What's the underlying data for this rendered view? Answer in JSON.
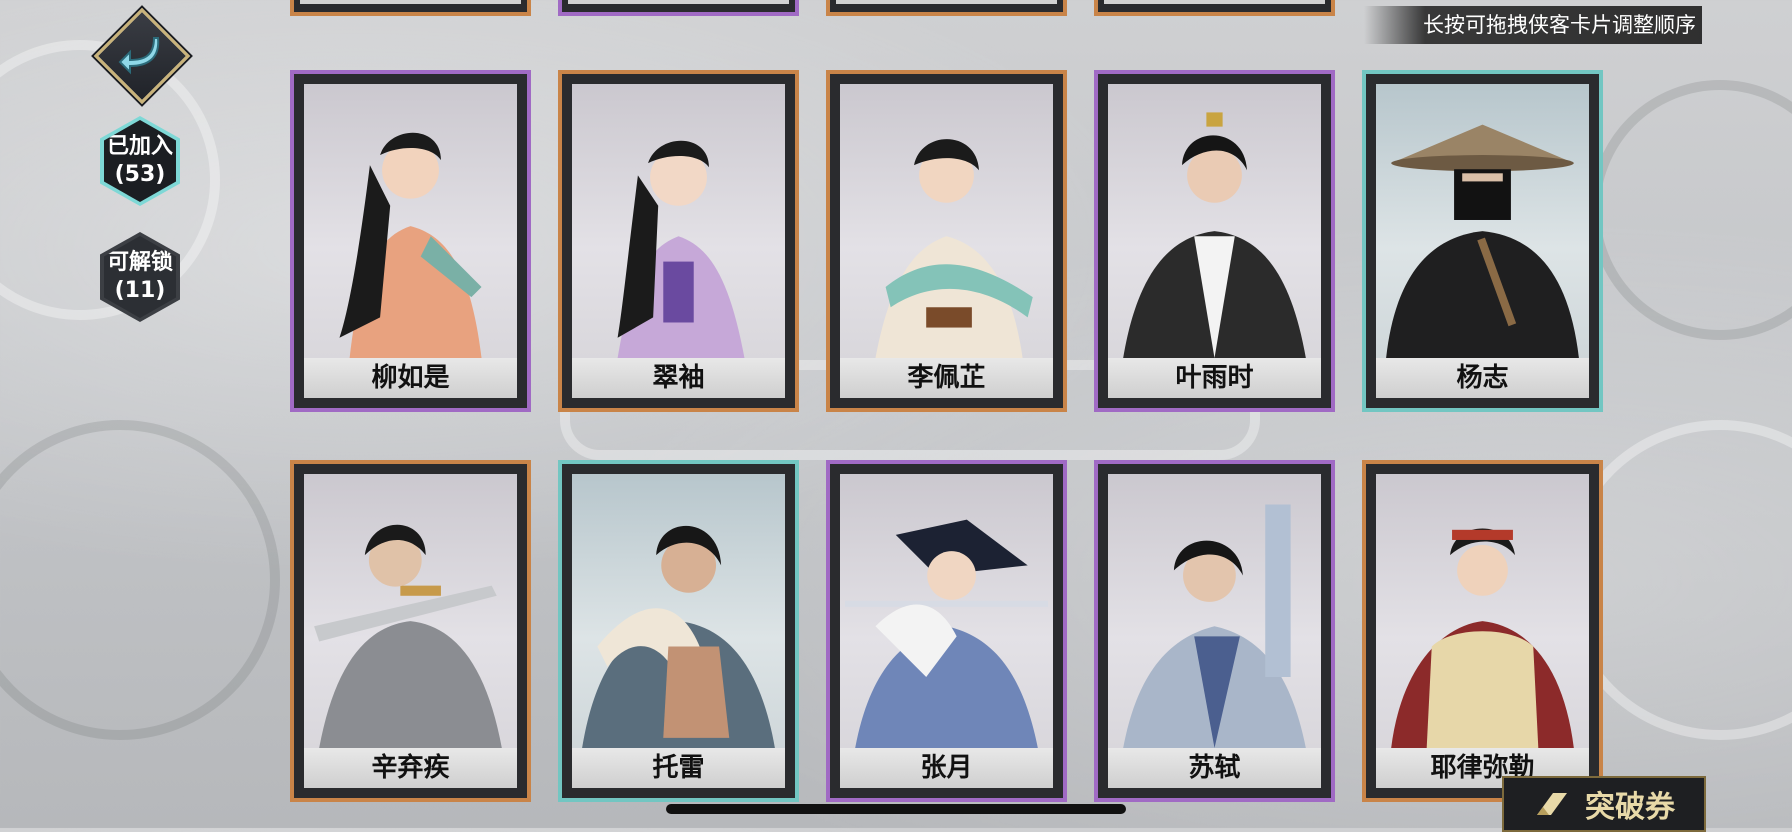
{
  "hud": {
    "joined_label": "已加入",
    "joined_count": "(53)",
    "unlockable_label": "可解锁",
    "unlockable_count": "(11)",
    "tip": "长按可拖拽侠客卡片调整顺序"
  },
  "cards": [
    {
      "name": "柳如是",
      "rarity": "purple"
    },
    {
      "name": "翠袖",
      "rarity": "orange"
    },
    {
      "name": "李佩芷",
      "rarity": "orange"
    },
    {
      "name": "叶雨时",
      "rarity": "purple"
    },
    {
      "name": "杨志",
      "rarity": "cyan"
    },
    {
      "name": "辛弃疾",
      "rarity": "orange"
    },
    {
      "name": "托雷",
      "rarity": "cyan"
    },
    {
      "name": "张月",
      "rarity": "purple"
    },
    {
      "name": "苏轼",
      "rarity": "purple"
    },
    {
      "name": "耶律弥勒",
      "rarity": "orange"
    }
  ],
  "breakthrough": {
    "label": "突破券",
    "icon": "scroll-icon"
  },
  "colors": {
    "purple": "#a06ac4",
    "orange": "#c98448",
    "cyan": "#72c6c2",
    "accent": "#7ed8d6"
  }
}
